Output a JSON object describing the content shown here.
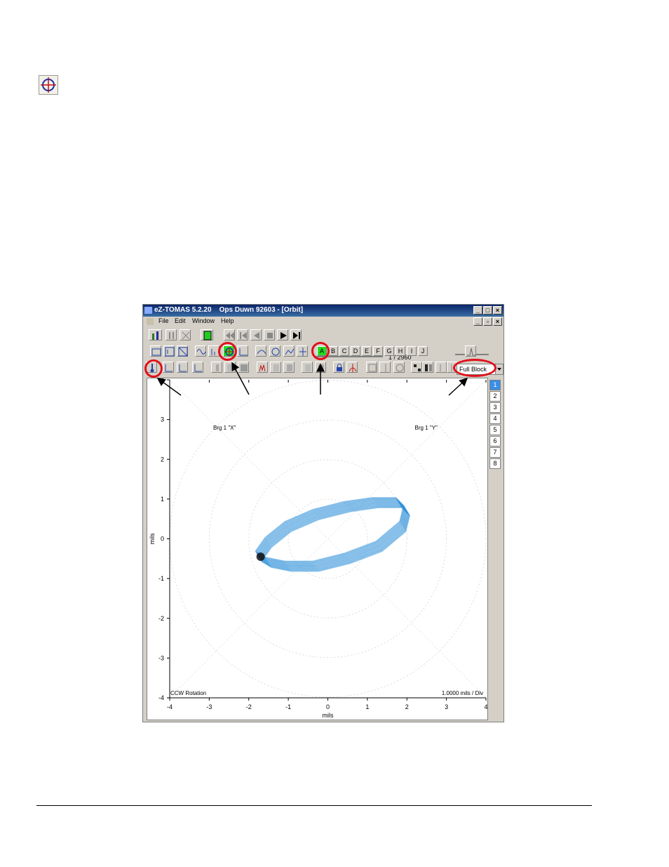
{
  "window": {
    "title": "eZ-TOMAS 5.2.20    Ops Duwn 92603 - [Orbit]"
  },
  "menu": [
    "File",
    "Edit",
    "Window",
    "Help"
  ],
  "playback": {
    "position_text": "1 / 2960"
  },
  "letters": [
    "A",
    "B",
    "C",
    "D",
    "E",
    "F",
    "G",
    "H",
    "I",
    "J"
  ],
  "block_select": {
    "value": "Full Block"
  },
  "pages": [
    "1",
    "2",
    "3",
    "4",
    "5",
    "6",
    "7",
    "8"
  ],
  "plot": {
    "label_x_probe": "Brg 1 \"X\"",
    "label_y_probe": "Brg 1 \"Y\"",
    "rotation": "CCW Rotation",
    "scale": "1.0000 mils / Div",
    "xlabel": "mils",
    "ylabel": "mils"
  },
  "chart_data": {
    "type": "scatter",
    "title": "",
    "xlabel": "mils",
    "ylabel": "mils",
    "xlim": [
      -4,
      4
    ],
    "ylim": [
      -4,
      4
    ],
    "x_ticks": [
      "-4",
      "-3",
      "-2",
      "-1",
      "0",
      "1",
      "2",
      "3",
      "4"
    ],
    "y_ticks": [
      "4",
      "3",
      "2",
      "1",
      "0",
      "-1",
      "-2",
      "-3",
      "-4"
    ],
    "series": [
      {
        "color": "#2e8fd8",
        "x": [
          -1.75,
          -1.5,
          -1.0,
          -0.3,
          0.5,
          1.3,
          1.9,
          2.0,
          1.8,
          1.2,
          0.5,
          -0.3,
          -1.0,
          -1.5,
          -1.75
        ],
        "y": [
          -0.45,
          -0.6,
          -0.7,
          -0.7,
          -0.5,
          -0.2,
          0.3,
          0.7,
          0.9,
          0.9,
          0.8,
          0.6,
          0.3,
          -0.1,
          -0.45
        ]
      }
    ],
    "marker_point": [
      -1.7,
      -0.45
    ],
    "grid": "concentric-circles",
    "colors": {
      "trace": "#2e8fd8",
      "highlight_ring": "#e0101a"
    }
  }
}
